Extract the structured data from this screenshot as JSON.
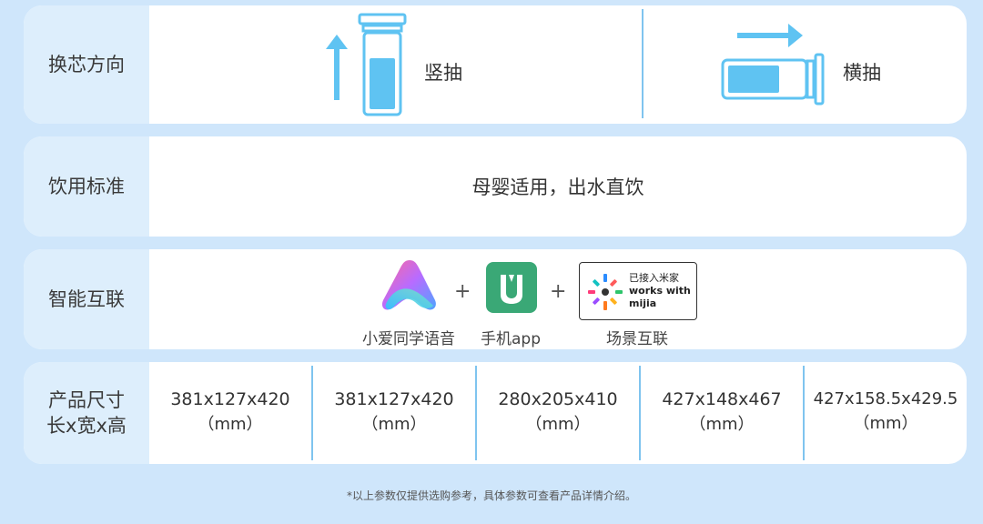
{
  "rows": {
    "direction": {
      "label": "换芯方向",
      "vertical": "竖抽",
      "horizontal": "横抽"
    },
    "standard": {
      "label": "饮用标准",
      "text": "母婴适用，出水直饮"
    },
    "connect": {
      "label": "智能互联",
      "plus": "+",
      "items": [
        {
          "caption": "小爱同学语音",
          "icon": "xiaoai-icon"
        },
        {
          "caption": "手机app",
          "icon": "mi-home-app-icon"
        },
        {
          "caption": "场景互联",
          "icon": "works-with-mijia-icon",
          "badge_line1": "已接入米家",
          "badge_line2": "works with",
          "badge_line3": "mijia"
        }
      ]
    },
    "size": {
      "label_line1": "产品尺寸",
      "label_line2": "长x宽x高",
      "unit": "（mm）",
      "values": [
        "381x127x420",
        "381x127x420",
        "280x205x410",
        "427x148x467",
        "427x158.5x429.5"
      ]
    }
  },
  "footnote": "*以上参数仅提供选购参考，具体参数可查看产品详情介绍。",
  "colors": {
    "background": "#cfe6fb",
    "label_bg": "#ddeefc",
    "accent": "#5fc3f2",
    "divider": "#7fc4ef",
    "mi_green": "#3aa876"
  }
}
